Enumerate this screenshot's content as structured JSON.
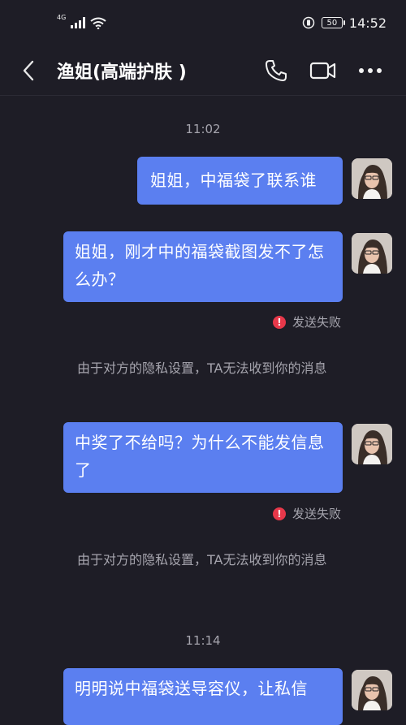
{
  "status_bar": {
    "network_type": "4G",
    "battery_level": "50",
    "time": "14:52"
  },
  "header": {
    "title": "渔姐(高端护肤 )",
    "back_icon": "chevron-left-icon",
    "call_icon": "phone-icon",
    "video_icon": "video-camera-icon",
    "more_icon": "more-dots-icon"
  },
  "messages": {
    "time_1": "11:02",
    "msg_1": "姐姐，中福袋了联系谁",
    "msg_2": "姐姐，刚才中的福袋截图发不了怎么办？",
    "fail_1": "发送失败",
    "notice_1": "由于对方的隐私设置，TA无法收到你的消息",
    "msg_3": "中奖了不给吗？为什么不能发信息了",
    "fail_2": "发送失败",
    "notice_2": "由于对方的隐私设置，TA无法收到你的消息",
    "time_2": "11:14",
    "msg_4": "明明说中福袋送导容仪，让私信"
  },
  "colors": {
    "background": "#1e1d26",
    "bubble": "#5b7ff0",
    "fail": "#e7384a",
    "muted_text": "#a5a4ad"
  }
}
